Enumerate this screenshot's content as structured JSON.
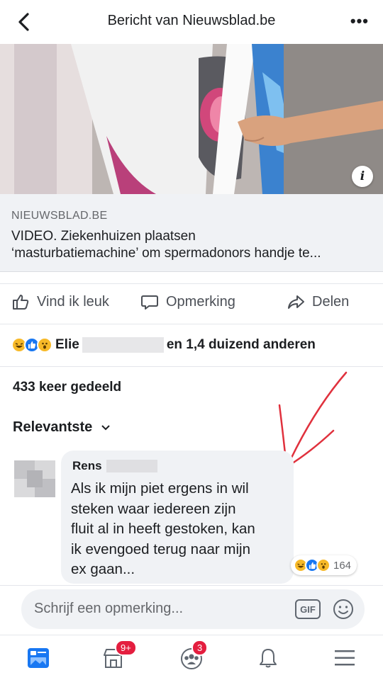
{
  "header": {
    "title": "Bericht van Nieuwsblad.be",
    "more": "•••"
  },
  "media": {
    "info_icon": "i"
  },
  "link": {
    "domain": "NIEUWSBLAD.BE",
    "title_line1": "VIDEO. Ziekenhuizen plaatsen",
    "title_line2": "‘masturbatiemachine’ om spermadonors handje te..."
  },
  "actions": {
    "like": "Vind ik leuk",
    "comment": "Opmerking",
    "share": "Delen"
  },
  "reactions": {
    "icons": [
      "haha-icon",
      "like-icon",
      "wow-icon"
    ],
    "name": "Elie",
    "rest": "en 1,4 duizend anderen"
  },
  "shares": "433 keer gedeeld",
  "sort": {
    "label": "Relevantste"
  },
  "comment": {
    "author": "Rens",
    "text": "Als ik mijn piet ergens in wil\nsteken waar iedereen zijn\nfluit al in heeft gestoken, kan\nik evengoed terug naar mijn\nex gaan...",
    "reaction_icons": [
      "haha-icon",
      "like-icon",
      "wow-icon"
    ],
    "reaction_count": "164"
  },
  "composer": {
    "placeholder": "Schrijf een opmerking...",
    "gif": "GIF"
  },
  "nav": {
    "marketplace_badge": "9+",
    "groups_badge": "3"
  },
  "colors": {
    "accent": "#1877f2",
    "badge": "#e41e3f",
    "annotation": "#e0313d"
  }
}
